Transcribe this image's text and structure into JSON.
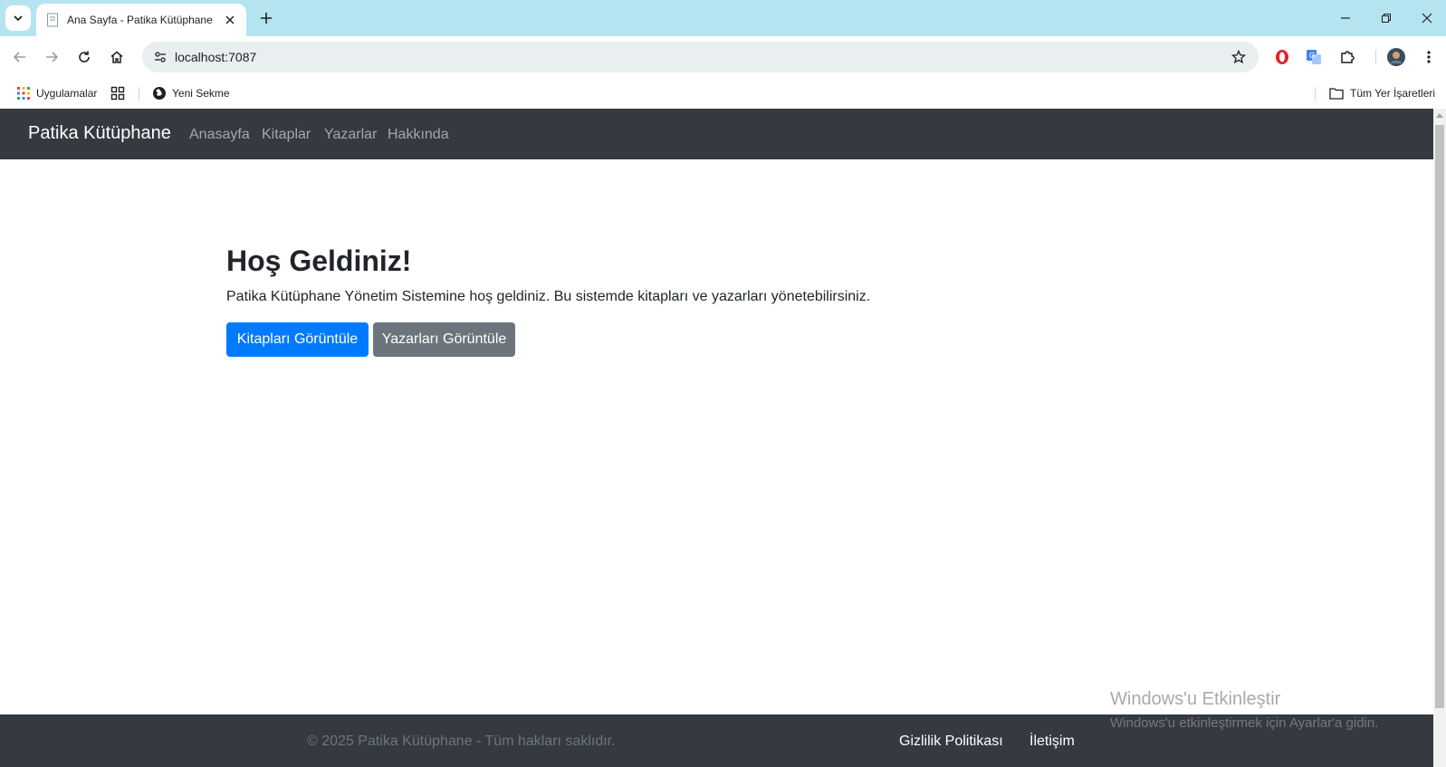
{
  "browser": {
    "tab_title": "Ana Sayfa - Patika Kütüphane",
    "url": "localhost:7087",
    "bookmarks": {
      "apps_label": "Uygulamalar",
      "new_tab_label": "Yeni Sekme",
      "all_bookmarks_label": "Tüm Yer İşaretleri"
    }
  },
  "navbar": {
    "brand": "Patika Kütüphane",
    "links": [
      "Anasayfa",
      "Kitaplar",
      "Yazarlar",
      "Hakkında"
    ]
  },
  "hero": {
    "title": "Hoş Geldiniz!",
    "text": "Patika Kütüphane Yönetim Sistemine hoş geldiniz. Bu sistemde kitapları ve yazarları yönetebilirsiniz.",
    "primary_button": "Kitapları Görüntüle",
    "secondary_button": "Yazarları Görüntüle"
  },
  "footer": {
    "copyright": "© 2025 Patika Kütüphane - Tüm hakları saklıdır.",
    "privacy_link": "Gizlilik Politikası",
    "contact_link": "İletişim"
  },
  "watermark": {
    "title": "Windows'u Etkinleştir",
    "subtitle": "Windows'u etkinleştirmek için Ayarlar'a gidin."
  },
  "colors": {
    "tabstrip": "#b5e4f1",
    "navbar": "#343a40",
    "primary": "#007bff",
    "secondary": "#6c757d"
  }
}
